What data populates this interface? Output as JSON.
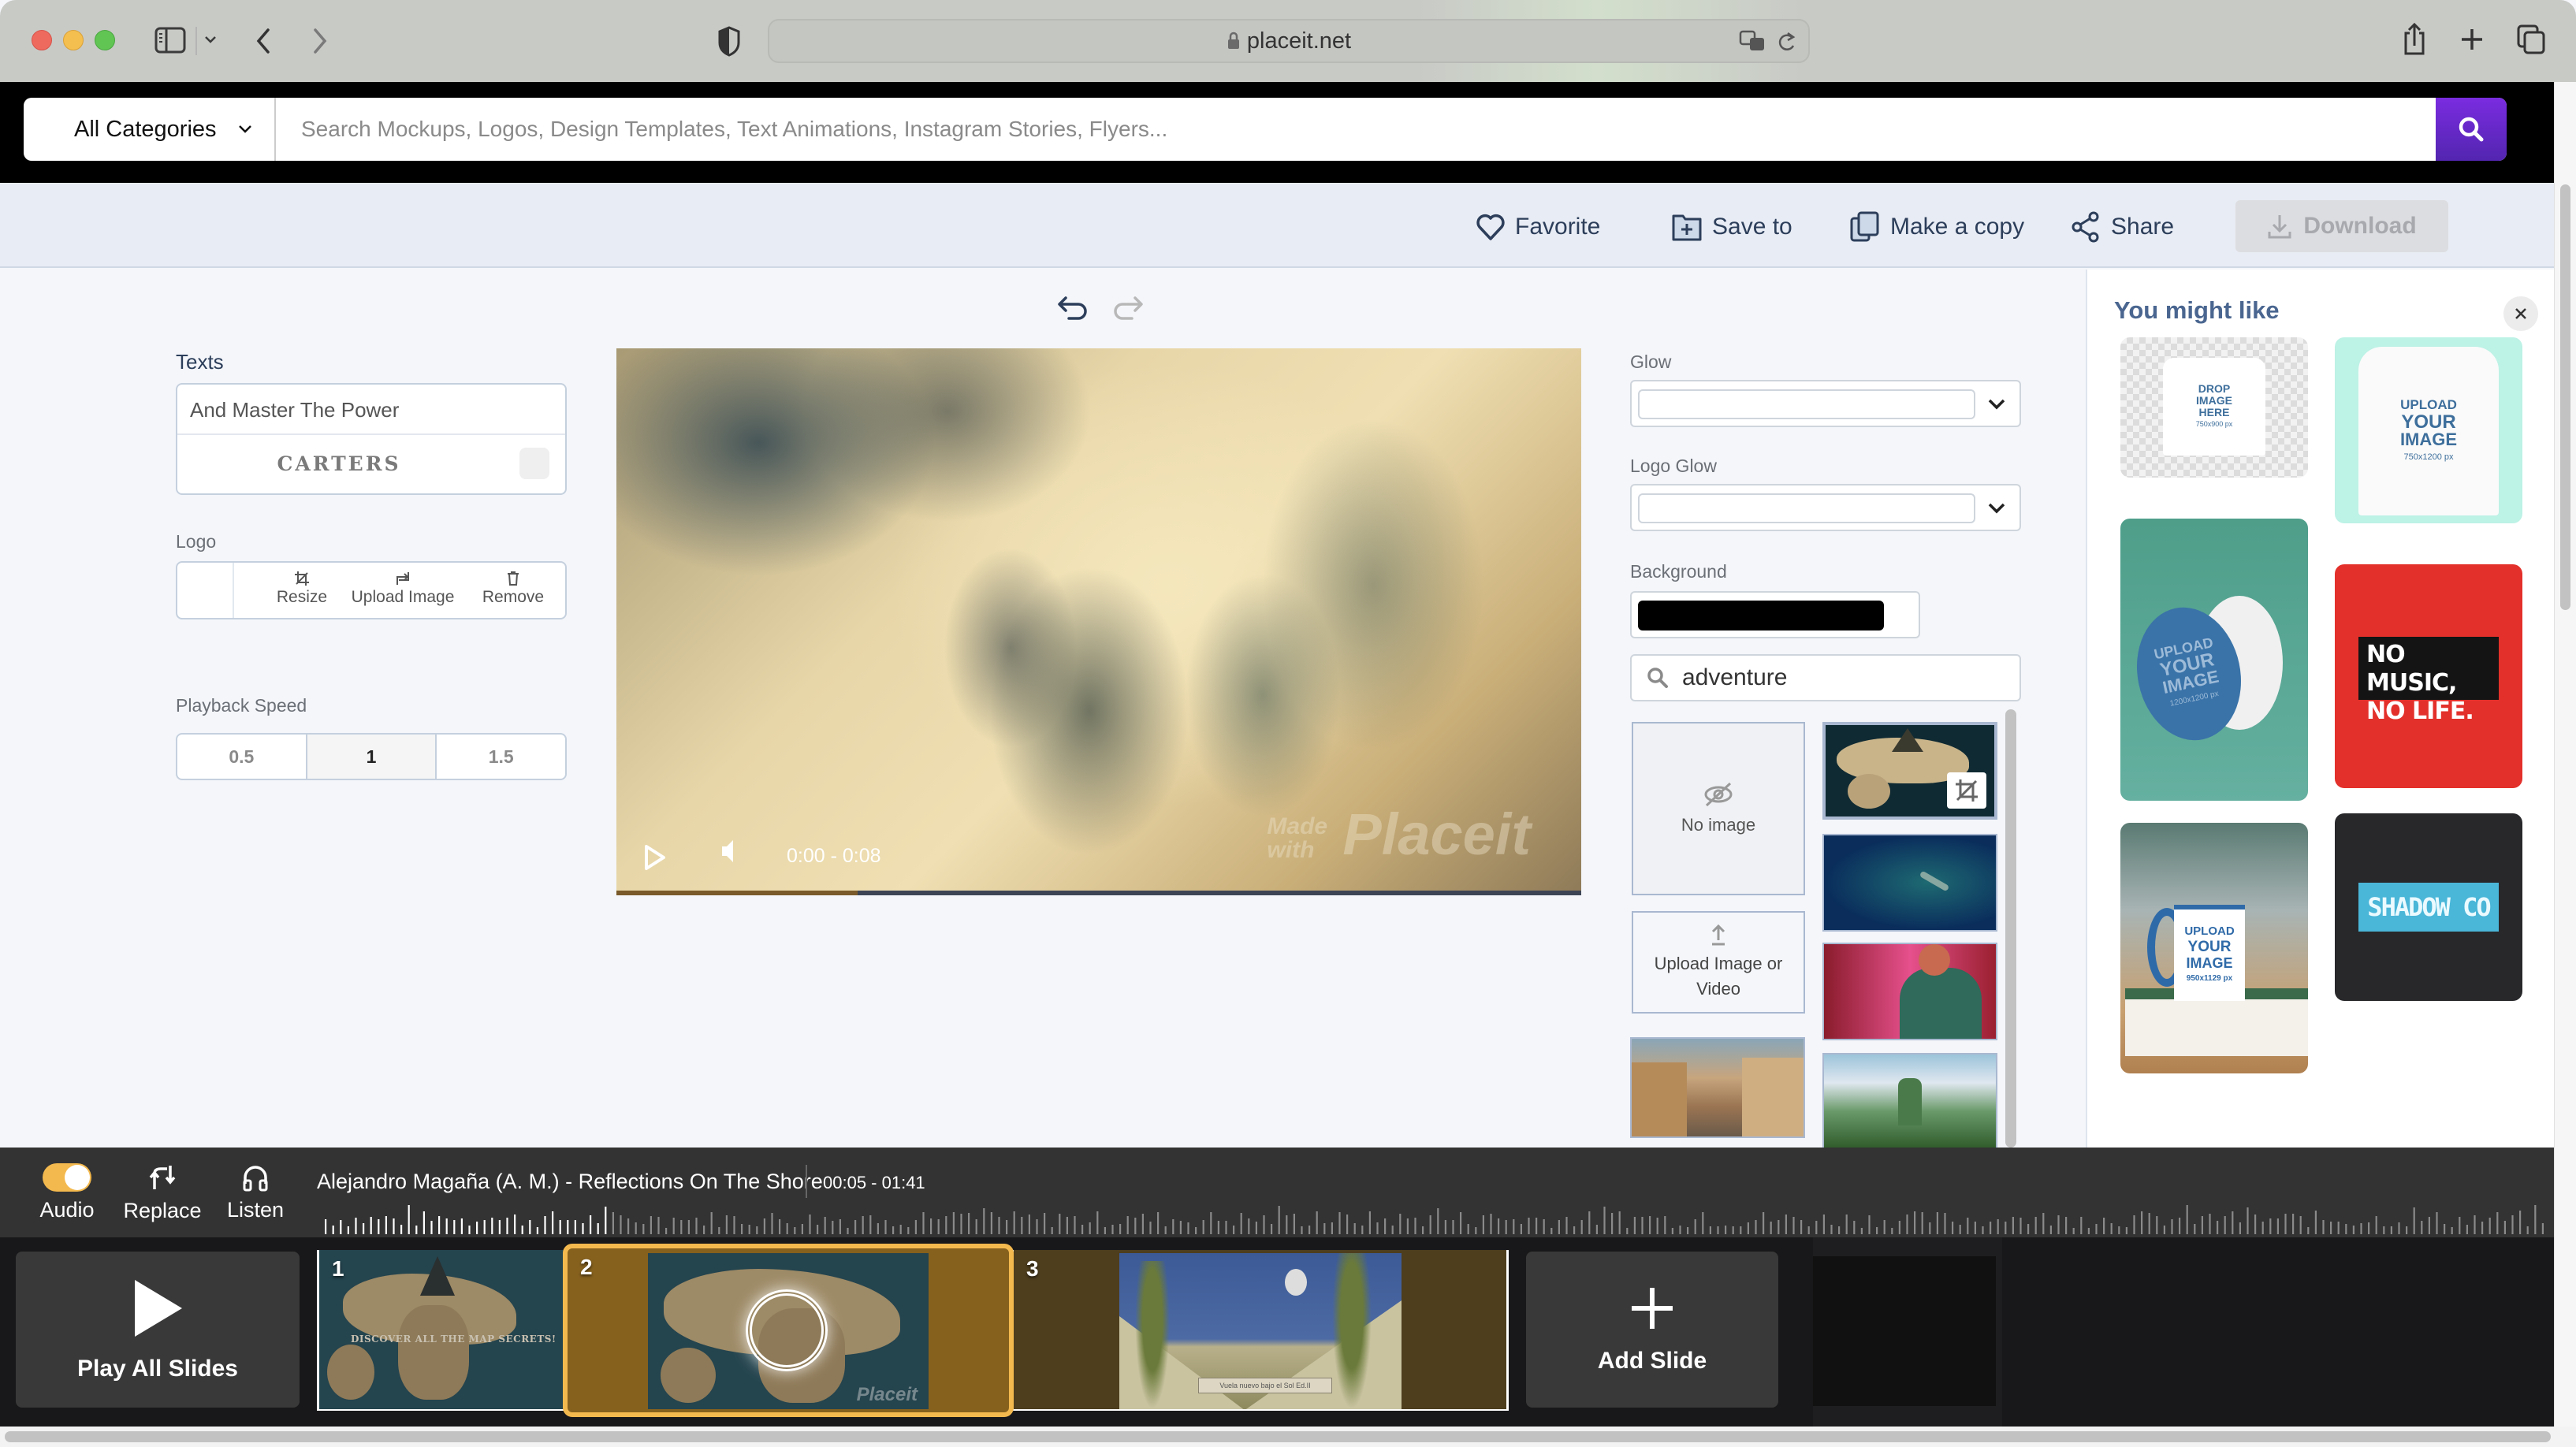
{
  "browser": {
    "url": "placeit.net",
    "icons": [
      "sidebar-toggle-icon",
      "chevron-down-icon",
      "back-icon",
      "forward-icon",
      "privacy-shield-icon",
      "lock-icon",
      "translate-icon",
      "reload-icon",
      "share-icon",
      "new-tab-icon",
      "tabs-overview-icon"
    ]
  },
  "search": {
    "category": "All Categories",
    "placeholder": "Search Mockups, Logos, Design Templates, Text Animations, Instagram Stories, Flyers...",
    "value": "",
    "button_icon": "search-icon",
    "accent": "#6a29cf"
  },
  "actions": {
    "favorite": "Favorite",
    "save_to": "Save to",
    "make_copy": "Make a copy",
    "share": "Share",
    "download": "Download"
  },
  "editor": {
    "texts_label": "Texts",
    "text_line_1": "And Master The Power",
    "text_line_2": "CARTERS",
    "logo_label": "Logo",
    "logo_actions": [
      "Resize",
      "Upload Image",
      "Remove"
    ],
    "playback_label": "Playback Speed",
    "speeds": [
      "0.5",
      "1",
      "1.5"
    ],
    "selected_speed": "1"
  },
  "video": {
    "time": "0:00 - 0:08",
    "progress": 0.25,
    "watermark_small": "Made with",
    "watermark_big": "Placeit"
  },
  "options": {
    "glow_label": "Glow",
    "glow_value": "",
    "logo_glow_label": "Logo Glow",
    "logo_glow_value": "",
    "background_label": "Background",
    "background_color": "#000000",
    "bg_search_value": "adventure",
    "no_image_label": "No image",
    "upload_label": "Upload Image or Video",
    "thumbnails": [
      "fantasy-island-map",
      "diver-underwater",
      "cyberpunk-character",
      "cartoon-town-street",
      "fantasy-valley-landscape"
    ],
    "selected_thumbnail": "fantasy-island-map"
  },
  "suggestions": {
    "title": "You might like",
    "items": [
      {
        "name": "kids-tshirt-mockup",
        "lines": [
          "DROP",
          "IMAGE",
          "HERE",
          "750x900 px"
        ]
      },
      {
        "name": "tshirt-back-mockup",
        "lines": [
          "UPLOAD",
          "YOUR",
          "IMAGE",
          "750x1200 px"
        ]
      },
      {
        "name": "phone-grip-mockup",
        "lines": [
          "UPLOAD",
          "YOUR",
          "IMAGE",
          "1200x1200 px"
        ]
      },
      {
        "name": "no-music-no-life-design",
        "lines": [
          "NO MUSIC,",
          "NO LIFE."
        ]
      },
      {
        "name": "mug-mockup",
        "lines": [
          "UPLOAD",
          "YOUR",
          "IMAGE",
          "950x1129 px"
        ]
      },
      {
        "name": "shadow-co-logo",
        "lines": [
          "SHADOW CO"
        ]
      }
    ]
  },
  "audio": {
    "toggle_label": "Audio",
    "toggle_on": true,
    "replace_label": "Replace",
    "listen_label": "Listen",
    "track": "Alejandro Magaña (A. M.) - Reflections On The Shore",
    "range": "00:05 - 01:41",
    "played_fraction": 0.13,
    "accent": "#f4b94e"
  },
  "slides": {
    "play_all": "Play All Slides",
    "add_slide": "Add Slide",
    "items": [
      {
        "number": "1",
        "caption": "DISCOVER ALL THE MAP SECRETS!",
        "selected": false
      },
      {
        "number": "2",
        "caption": "",
        "selected": true
      },
      {
        "number": "3",
        "caption": "Vuela nuevo bajo el Sol Ed.II",
        "selected": false
      }
    ]
  }
}
